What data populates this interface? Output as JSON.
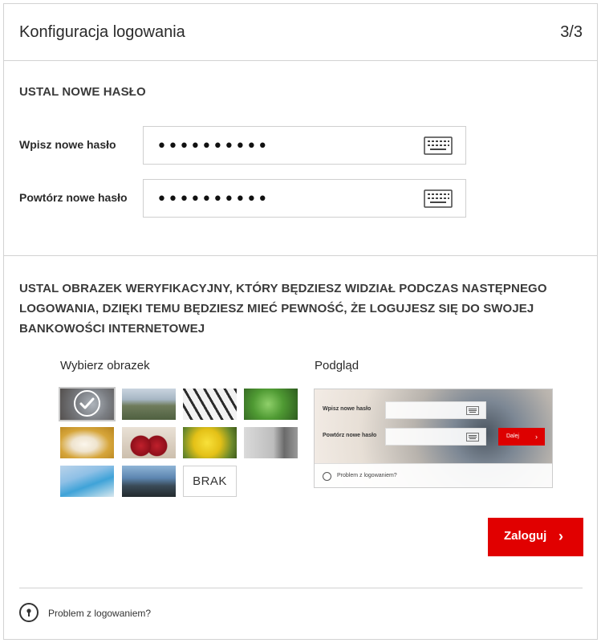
{
  "header": {
    "title": "Konfiguracja logowania",
    "step": "3/3"
  },
  "password_section": {
    "title": "USTAL NOWE HASŁO",
    "new_password": {
      "label": "Wpisz nowe hasło",
      "value": "**********"
    },
    "repeat_password": {
      "label": "Powtórz nowe hasło",
      "value": "**********"
    },
    "keyboard_icon": "keyboard-icon"
  },
  "image_section": {
    "title": "USTAL OBRAZEK WERYFIKACYJNY, KTÓRY BĘDZIESZ WIDZIAŁ PODCZAS NASTĘPNEGO LOGOWANIA, DZIĘKI TEMU BĘDZIESZ MIEĆ PEWNOŚĆ, ŻE LOGUJESZ SIĘ DO SWOJEJ BANKOWOŚCI INTERNETOWEJ",
    "pick_label": "Wybierz obrazek",
    "preview_label": "Podgląd",
    "images": [
      "dandelion",
      "mountains",
      "piano",
      "basil",
      "bow",
      "cherries",
      "sunflower",
      "bicycle",
      "beach",
      "coast"
    ],
    "selected_image": "dandelion",
    "none_option": "BRAK",
    "preview": {
      "new_password_label": "Wpisz nowe hasło",
      "repeat_password_label": "Powtórz nowe hasło",
      "next_label": "Dalej",
      "help_text": "Problem z logowaniem?"
    }
  },
  "login_button": {
    "label": "Zaloguj"
  },
  "help": {
    "label": "Problem z logowaniem?",
    "icon": "keyhole-icon"
  },
  "colors": {
    "accent": "#e10000",
    "border": "#d2d2d2"
  }
}
